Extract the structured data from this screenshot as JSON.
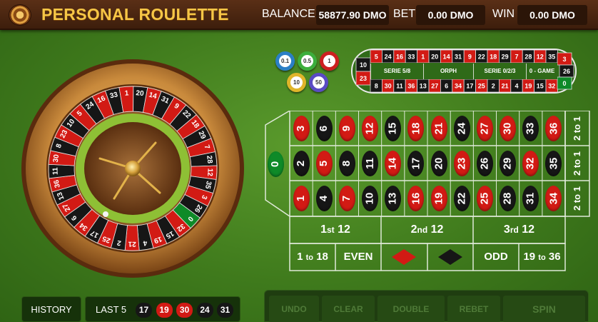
{
  "header": {
    "title": "PERSONAL ROULETTE",
    "balance_label": "BALANCE",
    "balance_value": "58877.90 DMO",
    "bet_label": "BET",
    "bet_value": "0.00 DMO",
    "win_label": "WIN",
    "win_value": "0.00 DMO"
  },
  "chips": [
    "0.1",
    "0.5",
    "1",
    "10",
    "50"
  ],
  "racetrack": {
    "top_row": [
      "5",
      "24",
      "16",
      "33",
      "1",
      "20",
      "14",
      "31",
      "9",
      "22",
      "18",
      "29",
      "7",
      "28",
      "12",
      "35"
    ],
    "bottom_row": [
      "8",
      "30",
      "11",
      "36",
      "13",
      "27",
      "6",
      "34",
      "17",
      "25",
      "2",
      "21",
      "4",
      "19",
      "15",
      "32"
    ],
    "left_end": [
      "10",
      "23"
    ],
    "right_end": [
      "3",
      "26",
      "0"
    ],
    "sections": [
      "SERIE 5/8",
      "ORPH",
      "SERIE 0/2/3",
      "0 - GAME"
    ]
  },
  "table": {
    "zero": "0",
    "rows": [
      [
        "3",
        "6",
        "9",
        "12",
        "15",
        "18",
        "21",
        "24",
        "27",
        "30",
        "33",
        "36"
      ],
      [
        "2",
        "5",
        "8",
        "11",
        "14",
        "17",
        "20",
        "23",
        "26",
        "29",
        "32",
        "35"
      ],
      [
        "1",
        "4",
        "7",
        "10",
        "13",
        "16",
        "19",
        "22",
        "25",
        "28",
        "31",
        "34"
      ]
    ],
    "column_bets": [
      "2 to 1",
      "2 to 1",
      "2 to 1"
    ],
    "dozens": [
      {
        "num": "1",
        "suffix": "st",
        "value": "12"
      },
      {
        "num": "2",
        "suffix": "nd",
        "value": "12"
      },
      {
        "num": "3",
        "suffix": "rd",
        "value": "12"
      }
    ],
    "outside": {
      "low_a": "1",
      "low_to": "to",
      "low_b": "18",
      "even": "EVEN",
      "odd": "ODD",
      "high_a": "19",
      "high_to": "to",
      "high_b": "36"
    }
  },
  "wheel_numbers": [
    "0",
    "32",
    "15",
    "19",
    "4",
    "21",
    "2",
    "25",
    "17",
    "34",
    "6",
    "27",
    "13",
    "36",
    "11",
    "30",
    "8",
    "23",
    "10",
    "5",
    "24",
    "16",
    "33",
    "1",
    "20",
    "14",
    "31",
    "9",
    "22",
    "18",
    "29",
    "7",
    "28",
    "12",
    "35",
    "3",
    "26"
  ],
  "red_numbers": [
    "1",
    "3",
    "5",
    "7",
    "9",
    "12",
    "14",
    "16",
    "18",
    "19",
    "21",
    "23",
    "25",
    "27",
    "30",
    "32",
    "34",
    "36"
  ],
  "history": {
    "button": "HISTORY",
    "last_label": "LAST 5",
    "numbers": [
      "17",
      "19",
      "30",
      "24",
      "31"
    ]
  },
  "controls": [
    "UNDO",
    "CLEAR",
    "DOUBLE",
    "REBET",
    "SPIN"
  ],
  "colors": {
    "red": "#d21a14",
    "black": "#161616",
    "green": "#0e8a28",
    "gold": "#f6c646",
    "felt": "#3f7a1c"
  }
}
